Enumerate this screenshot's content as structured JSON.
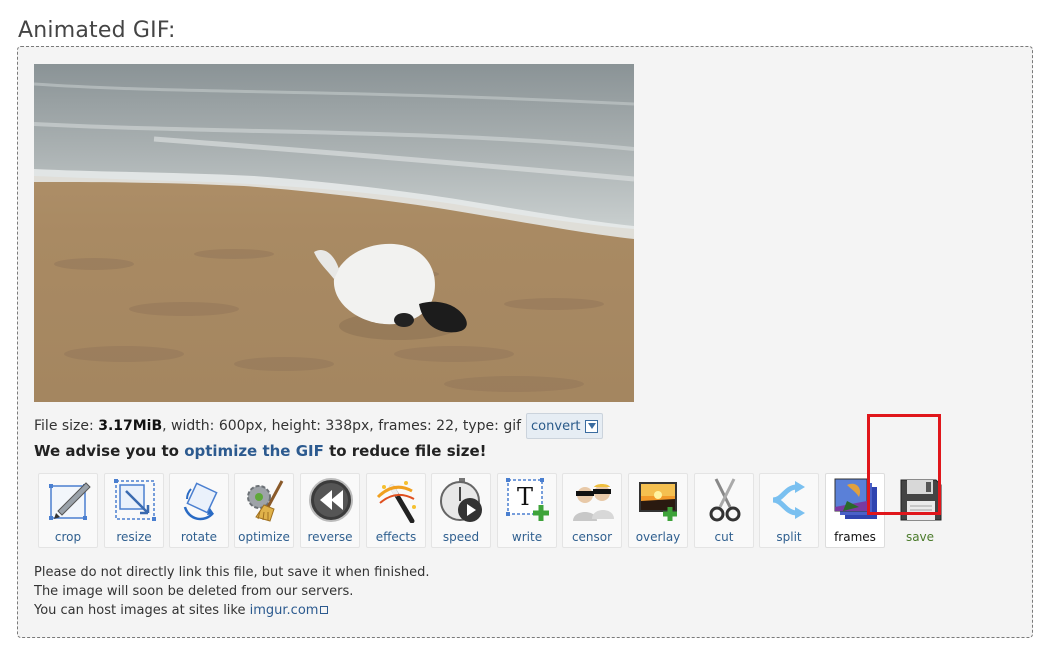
{
  "page": {
    "title": "Animated GIF:"
  },
  "file_info": {
    "prefix": "File size:",
    "size": "3.17MiB",
    "rest": ", width: 600px, height: 338px, frames: 22, type: gif",
    "convert_label": "convert"
  },
  "advice": {
    "before": "We advise you to ",
    "link": "optimize the GIF",
    "after": " to reduce file size!"
  },
  "tools": [
    {
      "label": "crop",
      "icon": "crop-icon"
    },
    {
      "label": "resize",
      "icon": "resize-icon"
    },
    {
      "label": "rotate",
      "icon": "rotate-icon"
    },
    {
      "label": "optimize",
      "icon": "optimize-icon"
    },
    {
      "label": "reverse",
      "icon": "reverse-icon"
    },
    {
      "label": "effects",
      "icon": "effects-icon"
    },
    {
      "label": "speed",
      "icon": "speed-icon"
    },
    {
      "label": "write",
      "icon": "write-icon"
    },
    {
      "label": "censor",
      "icon": "censor-icon"
    },
    {
      "label": "overlay",
      "icon": "overlay-icon"
    },
    {
      "label": "cut",
      "icon": "cut-icon"
    },
    {
      "label": "split",
      "icon": "split-icon"
    },
    {
      "label": "frames",
      "icon": "frames-icon"
    },
    {
      "label": "save",
      "icon": "save-icon"
    }
  ],
  "notes": {
    "line1": "Please do not directly link this file, but save it when finished.",
    "line2": "The image will soon be deleted from our servers.",
    "line3_before": "You can host images at sites like ",
    "line3_link": "imgur.com"
  },
  "colors": {
    "link": "#2c5a8f",
    "highlight": "#e0161b",
    "panel_bg": "#f4f4f4"
  }
}
